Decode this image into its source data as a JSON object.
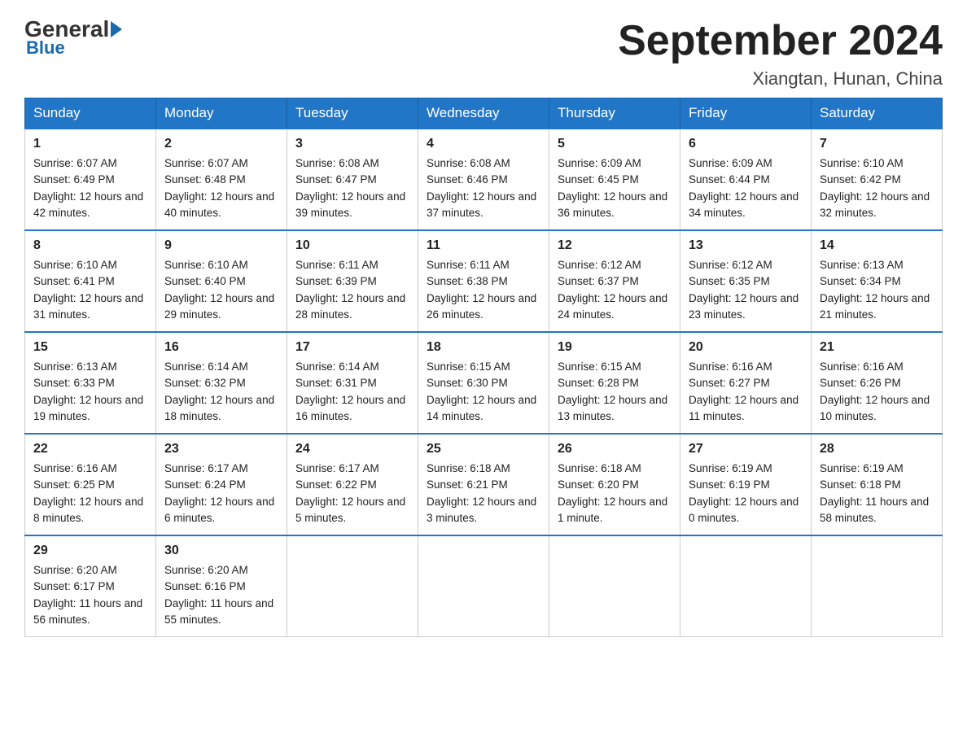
{
  "logo": {
    "general": "General",
    "blue": "Blue"
  },
  "header": {
    "title": "September 2024",
    "location": "Xiangtan, Hunan, China"
  },
  "days_of_week": [
    "Sunday",
    "Monday",
    "Tuesday",
    "Wednesday",
    "Thursday",
    "Friday",
    "Saturday"
  ],
  "weeks": [
    [
      {
        "day": 1,
        "sunrise": "6:07 AM",
        "sunset": "6:49 PM",
        "daylight": "12 hours and 42 minutes."
      },
      {
        "day": 2,
        "sunrise": "6:07 AM",
        "sunset": "6:48 PM",
        "daylight": "12 hours and 40 minutes."
      },
      {
        "day": 3,
        "sunrise": "6:08 AM",
        "sunset": "6:47 PM",
        "daylight": "12 hours and 39 minutes."
      },
      {
        "day": 4,
        "sunrise": "6:08 AM",
        "sunset": "6:46 PM",
        "daylight": "12 hours and 37 minutes."
      },
      {
        "day": 5,
        "sunrise": "6:09 AM",
        "sunset": "6:45 PM",
        "daylight": "12 hours and 36 minutes."
      },
      {
        "day": 6,
        "sunrise": "6:09 AM",
        "sunset": "6:44 PM",
        "daylight": "12 hours and 34 minutes."
      },
      {
        "day": 7,
        "sunrise": "6:10 AM",
        "sunset": "6:42 PM",
        "daylight": "12 hours and 32 minutes."
      }
    ],
    [
      {
        "day": 8,
        "sunrise": "6:10 AM",
        "sunset": "6:41 PM",
        "daylight": "12 hours and 31 minutes."
      },
      {
        "day": 9,
        "sunrise": "6:10 AM",
        "sunset": "6:40 PM",
        "daylight": "12 hours and 29 minutes."
      },
      {
        "day": 10,
        "sunrise": "6:11 AM",
        "sunset": "6:39 PM",
        "daylight": "12 hours and 28 minutes."
      },
      {
        "day": 11,
        "sunrise": "6:11 AM",
        "sunset": "6:38 PM",
        "daylight": "12 hours and 26 minutes."
      },
      {
        "day": 12,
        "sunrise": "6:12 AM",
        "sunset": "6:37 PM",
        "daylight": "12 hours and 24 minutes."
      },
      {
        "day": 13,
        "sunrise": "6:12 AM",
        "sunset": "6:35 PM",
        "daylight": "12 hours and 23 minutes."
      },
      {
        "day": 14,
        "sunrise": "6:13 AM",
        "sunset": "6:34 PM",
        "daylight": "12 hours and 21 minutes."
      }
    ],
    [
      {
        "day": 15,
        "sunrise": "6:13 AM",
        "sunset": "6:33 PM",
        "daylight": "12 hours and 19 minutes."
      },
      {
        "day": 16,
        "sunrise": "6:14 AM",
        "sunset": "6:32 PM",
        "daylight": "12 hours and 18 minutes."
      },
      {
        "day": 17,
        "sunrise": "6:14 AM",
        "sunset": "6:31 PM",
        "daylight": "12 hours and 16 minutes."
      },
      {
        "day": 18,
        "sunrise": "6:15 AM",
        "sunset": "6:30 PM",
        "daylight": "12 hours and 14 minutes."
      },
      {
        "day": 19,
        "sunrise": "6:15 AM",
        "sunset": "6:28 PM",
        "daylight": "12 hours and 13 minutes."
      },
      {
        "day": 20,
        "sunrise": "6:16 AM",
        "sunset": "6:27 PM",
        "daylight": "12 hours and 11 minutes."
      },
      {
        "day": 21,
        "sunrise": "6:16 AM",
        "sunset": "6:26 PM",
        "daylight": "12 hours and 10 minutes."
      }
    ],
    [
      {
        "day": 22,
        "sunrise": "6:16 AM",
        "sunset": "6:25 PM",
        "daylight": "12 hours and 8 minutes."
      },
      {
        "day": 23,
        "sunrise": "6:17 AM",
        "sunset": "6:24 PM",
        "daylight": "12 hours and 6 minutes."
      },
      {
        "day": 24,
        "sunrise": "6:17 AM",
        "sunset": "6:22 PM",
        "daylight": "12 hours and 5 minutes."
      },
      {
        "day": 25,
        "sunrise": "6:18 AM",
        "sunset": "6:21 PM",
        "daylight": "12 hours and 3 minutes."
      },
      {
        "day": 26,
        "sunrise": "6:18 AM",
        "sunset": "6:20 PM",
        "daylight": "12 hours and 1 minute."
      },
      {
        "day": 27,
        "sunrise": "6:19 AM",
        "sunset": "6:19 PM",
        "daylight": "12 hours and 0 minutes."
      },
      {
        "day": 28,
        "sunrise": "6:19 AM",
        "sunset": "6:18 PM",
        "daylight": "11 hours and 58 minutes."
      }
    ],
    [
      {
        "day": 29,
        "sunrise": "6:20 AM",
        "sunset": "6:17 PM",
        "daylight": "11 hours and 56 minutes."
      },
      {
        "day": 30,
        "sunrise": "6:20 AM",
        "sunset": "6:16 PM",
        "daylight": "11 hours and 55 minutes."
      },
      null,
      null,
      null,
      null,
      null
    ]
  ]
}
